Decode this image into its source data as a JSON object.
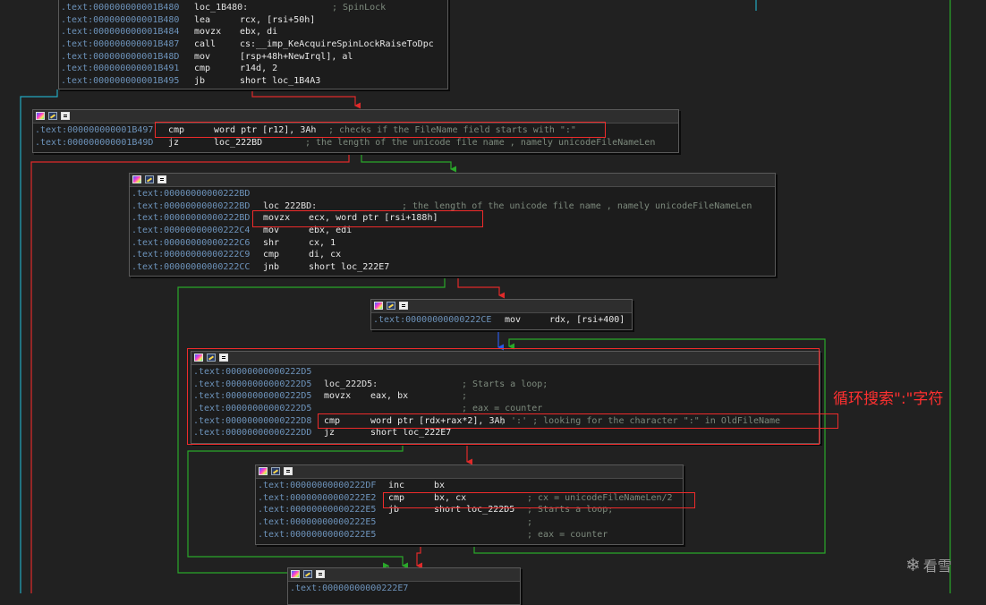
{
  "blocks": [
    {
      "lines": [
        {
          "addr": ".text:000000000001B480",
          "label": "loc_1B480:",
          "mnem": "",
          "ops": "",
          "comment": "; SpinLock"
        },
        {
          "addr": ".text:000000000001B480",
          "label": "",
          "mnem": "lea",
          "ops": "rcx, [rsi+50h]",
          "comment": ""
        },
        {
          "addr": ".text:000000000001B484",
          "label": "",
          "mnem": "movzx",
          "ops": "ebx, di",
          "comment": ""
        },
        {
          "addr": ".text:000000000001B487",
          "label": "",
          "mnem": "call",
          "ops": "cs:__imp_KeAcquireSpinLockRaiseToDpc",
          "comment": ""
        },
        {
          "addr": ".text:000000000001B48D",
          "label": "",
          "mnem": "mov",
          "ops": "[rsp+48h+NewIrql], al",
          "comment": ""
        },
        {
          "addr": ".text:000000000001B491",
          "label": "",
          "mnem": "cmp",
          "ops": "r14d, 2",
          "comment": ""
        },
        {
          "addr": ".text:000000000001B495",
          "label": "",
          "mnem": "jb",
          "ops": "short loc_1B4A3",
          "comment": ""
        }
      ]
    },
    {
      "lines": [
        {
          "addr": ".text:000000000001B497",
          "label": "",
          "mnem": "cmp",
          "ops": "word ptr [r12], 3Ah",
          "comment": "; checks if the FileName field starts with \":\""
        },
        {
          "addr": ".text:000000000001B49D",
          "label": "",
          "mnem": "jz",
          "ops": "loc_222BD",
          "comment": "; the length of the unicode file name , namely unicodeFileNameLen"
        }
      ]
    },
    {
      "lines": [
        {
          "addr": ".text:00000000000222BD",
          "label": "",
          "mnem": "",
          "ops": "",
          "comment": ""
        },
        {
          "addr": ".text:00000000000222BD",
          "label": "loc_222BD:",
          "mnem": "",
          "ops": "",
          "comment": "; the length of the unicode file name , namely unicodeFileNameLen"
        },
        {
          "addr": ".text:00000000000222BD",
          "label": "",
          "mnem": "movzx",
          "ops": "ecx, word ptr [rsi+188h]",
          "comment": ""
        },
        {
          "addr": ".text:00000000000222C4",
          "label": "",
          "mnem": "mov",
          "ops": "ebx, edi",
          "comment": ""
        },
        {
          "addr": ".text:00000000000222C6",
          "label": "",
          "mnem": "shr",
          "ops": "cx, 1",
          "comment": ""
        },
        {
          "addr": ".text:00000000000222C9",
          "label": "",
          "mnem": "cmp",
          "ops": "di, cx",
          "comment": ""
        },
        {
          "addr": ".text:00000000000222CC",
          "label": "",
          "mnem": "jnb",
          "ops": "short loc_222E7",
          "comment": ""
        }
      ]
    },
    {
      "lines": [
        {
          "addr": ".text:00000000000222CE",
          "label": "",
          "mnem": "mov",
          "ops": "rdx, [rsi+400]",
          "comment": ""
        }
      ]
    },
    {
      "lines": [
        {
          "addr": ".text:00000000000222D5",
          "label": "",
          "mnem": "",
          "ops": "",
          "comment": ""
        },
        {
          "addr": ".text:00000000000222D5",
          "label": "loc_222D5:",
          "mnem": "",
          "ops": "",
          "comment": "; Starts a loop;"
        },
        {
          "addr": ".text:00000000000222D5",
          "label": "",
          "mnem": "movzx",
          "ops": "eax, bx",
          "comment": ";"
        },
        {
          "addr": ".text:00000000000222D5",
          "label": "",
          "mnem": "",
          "ops": "",
          "comment": "; eax = counter"
        },
        {
          "addr": ".text:00000000000222D8",
          "label": "",
          "mnem": "cmp",
          "ops": "word ptr [rdx+rax*2], 3Ah",
          "comment": "; ':' ; looking for the character \":\" in OldFileName"
        },
        {
          "addr": ".text:00000000000222DD",
          "label": "",
          "mnem": "jz",
          "ops": "short loc_222E7",
          "comment": ""
        }
      ]
    },
    {
      "lines": [
        {
          "addr": ".text:00000000000222DF",
          "label": "",
          "mnem": "inc",
          "ops": "bx",
          "comment": ""
        },
        {
          "addr": ".text:00000000000222E2",
          "label": "",
          "mnem": "cmp",
          "ops": "bx, cx",
          "comment": "; cx = unicodeFileNameLen/2"
        },
        {
          "addr": ".text:00000000000222E5",
          "label": "",
          "mnem": "jb",
          "ops": "short loc_222D5",
          "comment": "; Starts a loop;"
        },
        {
          "addr": ".text:00000000000222E5",
          "label": "",
          "mnem": "",
          "ops": "",
          "comment": ";"
        },
        {
          "addr": ".text:00000000000222E5",
          "label": "",
          "mnem": "",
          "ops": "",
          "comment": "; eax = counter"
        }
      ]
    },
    {
      "lines": [
        {
          "addr": ".text:00000000000222E7",
          "label": "",
          "mnem": "",
          "ops": "",
          "comment": ""
        }
      ]
    }
  ],
  "annotation": "循环搜索\":\"字符",
  "watermark": "看雪",
  "colors": {
    "true_edge": "#2aa82a",
    "false_edge": "#e02a2a",
    "uncond_edge": "#2a5ae6",
    "back_edge": "#23a8c0",
    "highlight": "#ee2b2b"
  }
}
